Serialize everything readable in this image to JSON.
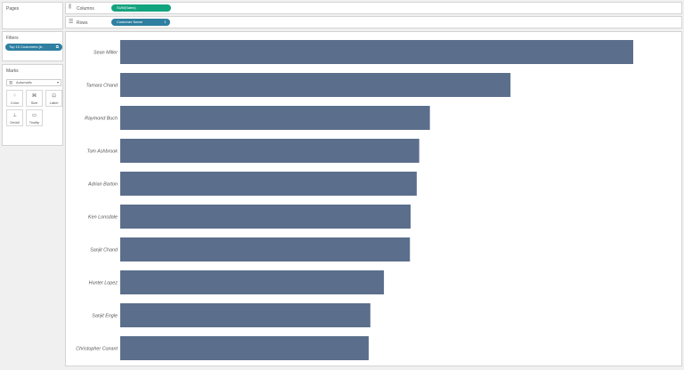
{
  "pages": {
    "title": "Pages"
  },
  "filters": {
    "title": "Filters",
    "pill_label": "Top 10 Customers (b..",
    "pill_icon": "link-icon"
  },
  "marks": {
    "title": "Marks",
    "type_select": "Automatic",
    "buttons": [
      {
        "label": "Color",
        "icon": "color-icon"
      },
      {
        "label": "Size",
        "icon": "size-icon"
      },
      {
        "label": "Label",
        "icon": "label-icon"
      },
      {
        "label": "Detail",
        "icon": "detail-icon"
      },
      {
        "label": "Tooltip",
        "icon": "tooltip-icon"
      }
    ]
  },
  "shelves": {
    "columns": {
      "label": "Columns",
      "pill": "SUM(Sales)"
    },
    "rows": {
      "label": "Rows",
      "pill": "Customer Name"
    }
  },
  "colors": {
    "bar": "#5b6e8c",
    "columns_pill": "#14a37f",
    "rows_pill": "#2f7fa1"
  },
  "chart_data": {
    "type": "bar",
    "orientation": "horizontal",
    "categories": [
      "Sean Miller",
      "Tamara Chand",
      "Raymond Buch",
      "Tom Ashbrook",
      "Adrian Barton",
      "Ken Lonsdale",
      "Sanjit Chand",
      "Hunter Lopez",
      "Sanjit Engle",
      "Christopher Conant"
    ],
    "values": [
      25043,
      19052,
      15117,
      14596,
      14474,
      14175,
      14142,
      12873,
      12210,
      12129
    ],
    "xlim": [
      0,
      26000
    ],
    "xlabel": "",
    "ylabel": "",
    "grid": false
  }
}
